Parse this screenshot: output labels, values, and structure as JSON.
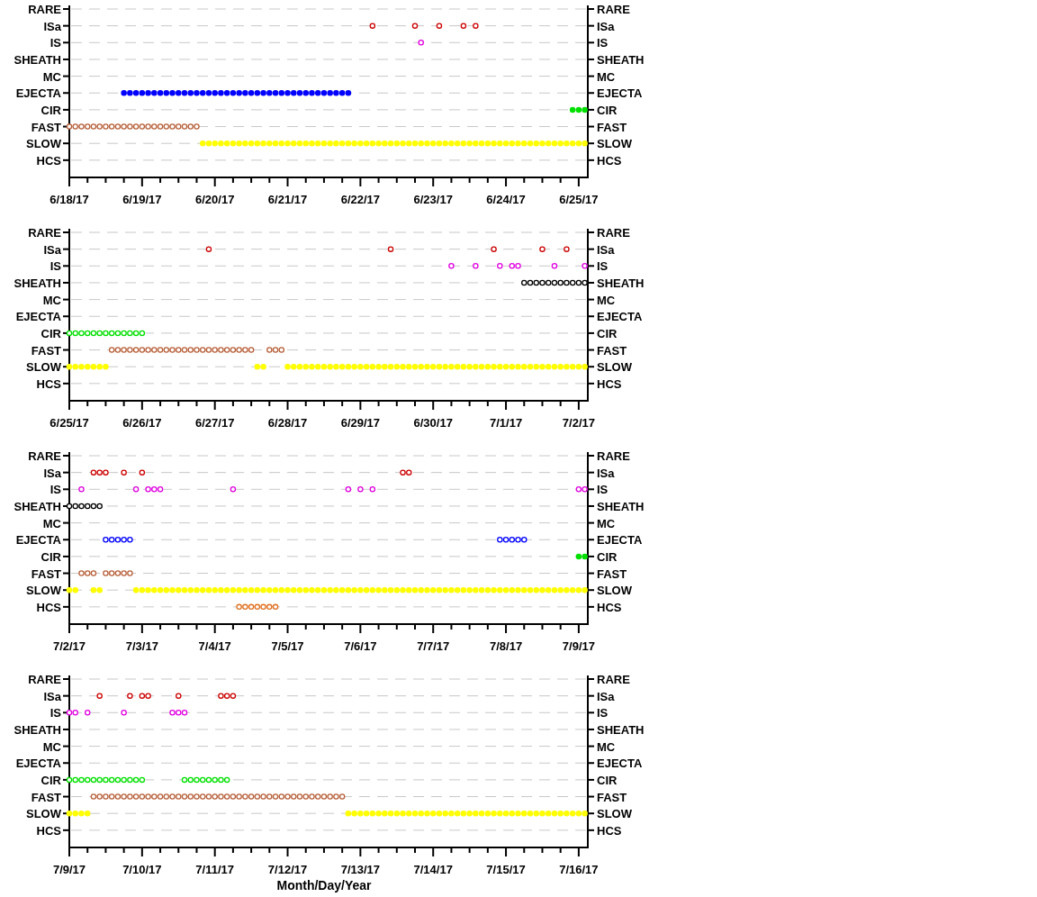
{
  "panels": [
    {
      "left_labels": [
        "RARE",
        "ISa",
        "IS",
        "SHEATH",
        "MC",
        "EJECTA",
        "CIR",
        "FAST",
        "SLOW",
        "HCS"
      ],
      "right_labels": [
        "RARE",
        "ISa",
        "IS",
        "SHEATH",
        "MC",
        "EJECTA",
        "CIR",
        "FAST",
        "SLOW",
        "HCS"
      ],
      "date_labels": [
        "6/18/17",
        "6/19/17",
        "6/20/17",
        "6/21/17",
        "6/22/17",
        "6/23/17",
        "6/24/17",
        "6/25/17"
      ]
    },
    {
      "left_labels": [
        "RARE",
        "ISa",
        "IS",
        "SHEATH",
        "MC",
        "EJECTA",
        "CIR",
        "FAST",
        "SLOW",
        "HCS"
      ],
      "right_labels": [
        "RARE",
        "ISa",
        "IS",
        "SHEATH",
        "MC",
        "EJECTA",
        "CIR",
        "FAST",
        "SLOW",
        "HCS"
      ],
      "date_labels": [
        "6/25/17",
        "6/26/17",
        "6/27/17",
        "6/28/17",
        "6/29/17",
        "6/30/17",
        "7/1/17",
        "7/2/17"
      ]
    },
    {
      "left_labels": [
        "RARE",
        "ISa",
        "IS",
        "SHEATH",
        "MC",
        "EJECTA",
        "CIR",
        "FAST",
        "SLOW",
        "HCS"
      ],
      "right_labels": [
        "RARE",
        "ISa",
        "IS",
        "SHEATH",
        "MC",
        "EJECTA",
        "CIR",
        "FAST",
        "SLOW",
        "HCS"
      ],
      "date_labels": [
        "7/2/17",
        "7/3/17",
        "7/4/17",
        "7/5/17",
        "7/6/17",
        "7/7/17",
        "7/8/17",
        "7/9/17"
      ]
    },
    {
      "left_labels": [
        "RARE",
        "ISa",
        "IS",
        "SHEATH",
        "MC",
        "EJECTA",
        "CIR",
        "FAST",
        "SLOW",
        "HCS"
      ],
      "right_labels": [
        "RARE",
        "ISa",
        "IS",
        "SHEATH",
        "MC",
        "EJECTA",
        "CIR",
        "FAST",
        "SLOW",
        "HCS"
      ],
      "date_labels": [
        "7/9/17",
        "7/10/17",
        "7/11/17",
        "7/12/17",
        "7/13/17",
        "7/14/17",
        "7/15/17",
        "7/16/17"
      ],
      "axis_title": "Month/Day/Year"
    }
  ]
}
